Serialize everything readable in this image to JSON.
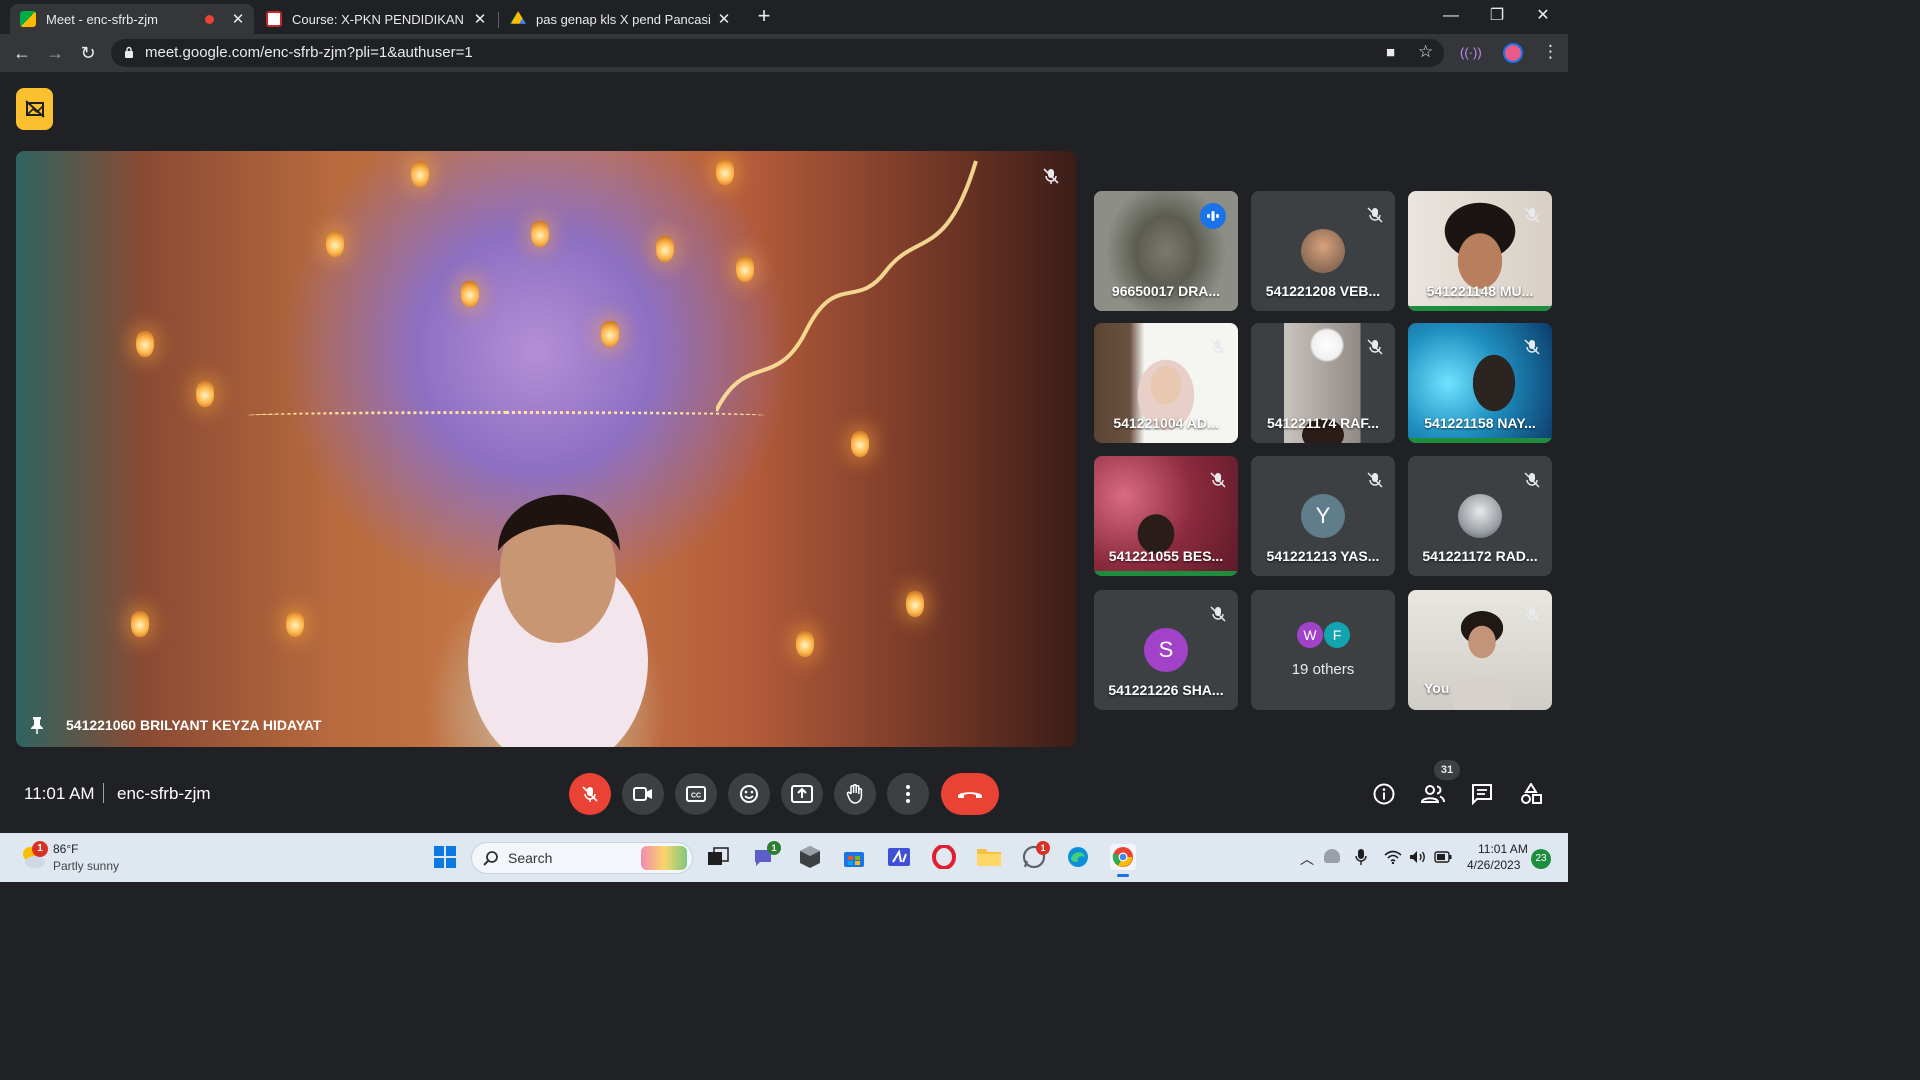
{
  "browser": {
    "tabs": [
      {
        "title": "Meet - enc-sfrb-zjm",
        "recording": true
      },
      {
        "title": "Course: X-PKN PENDIDIKAN PAN"
      },
      {
        "title": "pas genap kls X pend Pancasila -"
      }
    ],
    "new_tab": "+",
    "url": "meet.google.com/enc-sfrb-zjm?pli=1&authuser=1"
  },
  "meeting": {
    "main_speaker": "541221060 BRILYANT KEYZA HIDAYAT",
    "time": "11:01 AM",
    "code": "enc-sfrb-zjm",
    "people_count": "31",
    "participants": [
      {
        "name": "96650017 DRA...",
        "speaking": true
      },
      {
        "name": "541221208 VEB...",
        "muted": true
      },
      {
        "name": "541221148 MU...",
        "muted": true
      },
      {
        "name": "541221004 AD...",
        "muted": true
      },
      {
        "name": "541221174 RAF...",
        "muted": true
      },
      {
        "name": "541221158 NAY...",
        "muted": true
      },
      {
        "name": "541221055 BES...",
        "muted": true
      },
      {
        "name": "541221213 YAS...",
        "muted": true,
        "initial": "Y"
      },
      {
        "name": "541221172 RAD...",
        "muted": true
      },
      {
        "name": "541221226 SHA...",
        "muted": true,
        "initial": "S"
      },
      {
        "name": "19 others",
        "initials": [
          "W",
          "F"
        ]
      },
      {
        "name": "You",
        "muted": true
      }
    ]
  },
  "taskbar": {
    "weather_temp": "86°F",
    "weather_cond": "Partly sunny",
    "weather_badge": "1",
    "search_placeholder": "Search",
    "teams_badge": "1",
    "whatsapp_badge": "1",
    "clock_time": "11:01 AM",
    "clock_date": "4/26/2023",
    "notifications": "23"
  },
  "colors": {
    "accent_blue": "#1a73e8",
    "danger_red": "#ea4335",
    "badge_yellow": "#fbc02d",
    "tile_bg": "#3c4043"
  }
}
